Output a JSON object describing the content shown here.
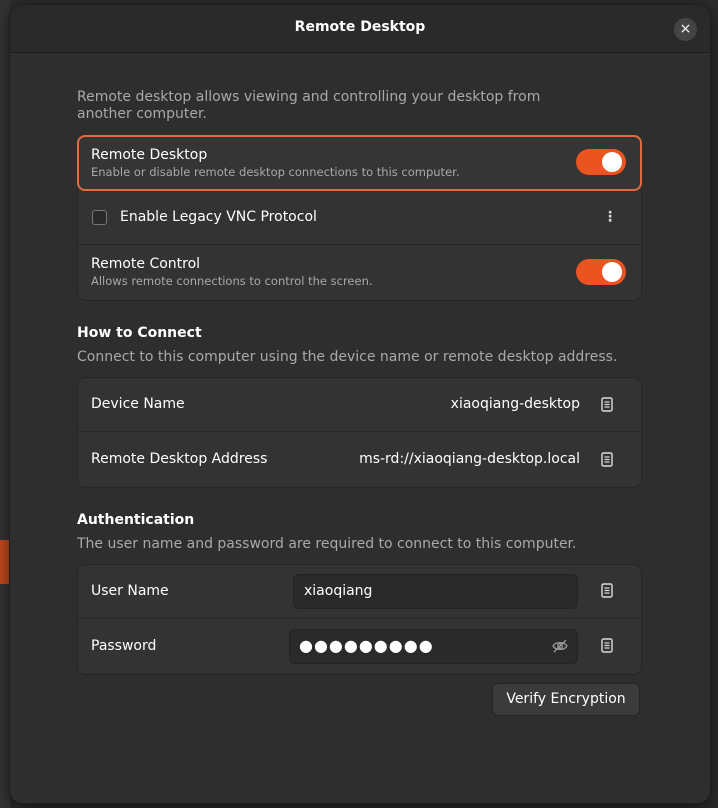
{
  "window": {
    "title": "Remote Desktop",
    "close_symbol": "×"
  },
  "intro": "Remote desktop allows viewing and controlling your desktop from another computer.",
  "sharing": {
    "remote_desktop": {
      "label": "Remote Desktop",
      "description": "Enable or disable remote desktop connections to this computer.",
      "enabled": true
    },
    "legacy_vnc": {
      "label": "Enable Legacy VNC Protocol",
      "checked": false,
      "menu_symbol": "⋮"
    },
    "remote_control": {
      "label": "Remote Control",
      "description": "Allows remote connections to control the screen.",
      "enabled": true
    }
  },
  "how_to_connect": {
    "title": "How to Connect",
    "description": "Connect to this computer using the device name or remote desktop address.",
    "device_name_label": "Device Name",
    "device_name_value": "xiaoqiang-desktop",
    "address_label": "Remote Desktop Address",
    "address_value": "ms-rd://xiaoqiang-desktop.local"
  },
  "authentication": {
    "title": "Authentication",
    "description": "The user name and password are required to connect to this computer.",
    "username_label": "User Name",
    "username_value": "xiaoqiang",
    "password_label": "Password",
    "password_masked": "●●●●●●●●●"
  },
  "verify_button": "Verify Encryption",
  "icons": {
    "copy": "copy-icon",
    "reveal": "eye-slash-icon",
    "close": "close-icon",
    "menu": "kebab-menu-icon"
  },
  "colors": {
    "accent": "#e95420",
    "focus_border": "#e06b3e",
    "background": "#2e2e2e",
    "card": "#333333"
  }
}
